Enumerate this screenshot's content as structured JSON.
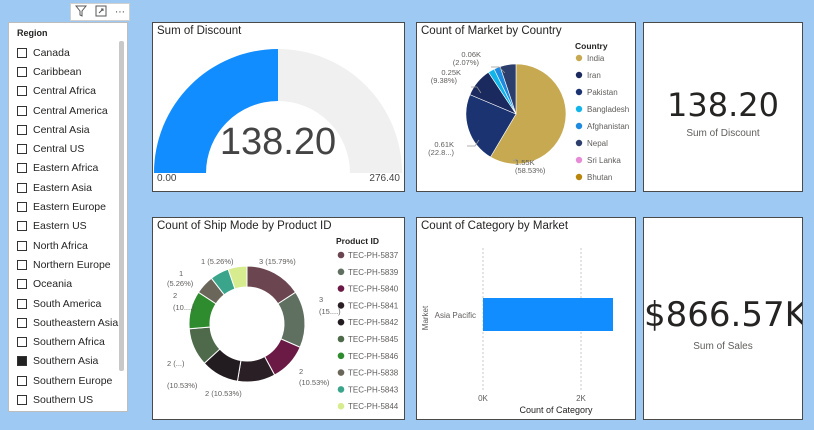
{
  "slicer": {
    "title": "Region",
    "items": [
      {
        "label": "Canada",
        "checked": false
      },
      {
        "label": "Caribbean",
        "checked": false
      },
      {
        "label": "Central Africa",
        "checked": false
      },
      {
        "label": "Central America",
        "checked": false
      },
      {
        "label": "Central Asia",
        "checked": false
      },
      {
        "label": "Central US",
        "checked": false
      },
      {
        "label": "Eastern Africa",
        "checked": false
      },
      {
        "label": "Eastern Asia",
        "checked": false
      },
      {
        "label": "Eastern Europe",
        "checked": false
      },
      {
        "label": "Eastern US",
        "checked": false
      },
      {
        "label": "North Africa",
        "checked": false
      },
      {
        "label": "Northern Europe",
        "checked": false
      },
      {
        "label": "Oceania",
        "checked": false
      },
      {
        "label": "South America",
        "checked": false
      },
      {
        "label": "Southeastern Asia",
        "checked": false
      },
      {
        "label": "Southern Africa",
        "checked": false
      },
      {
        "label": "Southern Asia",
        "checked": true
      },
      {
        "label": "Southern Europe",
        "checked": false
      },
      {
        "label": "Southern US",
        "checked": false
      },
      {
        "label": "",
        "checked": false
      }
    ],
    "toolbar": {
      "filter_icon": "filter-icon",
      "focus_icon": "focus-mode-icon",
      "more_icon": "more-options-icon"
    }
  },
  "gauge": {
    "title": "Sum of Discount",
    "value_label": "138.20",
    "min_label": "0.00",
    "max_label": "276.40",
    "value": 138.2,
    "min": 0,
    "max": 276.4,
    "fill_color": "#118dff",
    "track_color": "#f0f0f0"
  },
  "pie": {
    "title": "Count of Market by Country",
    "legend_title": "Country",
    "legend": [
      {
        "label": "India",
        "color": "#c6a951"
      },
      {
        "label": "Iran",
        "color": "#1a2a5e"
      },
      {
        "label": "Pakistan",
        "color": "#1b3370"
      },
      {
        "label": "Bangladesh",
        "color": "#12b5ea"
      },
      {
        "label": "Afghanistan",
        "color": "#1f8be0"
      },
      {
        "label": "Nepal",
        "color": "#2c3e6b"
      },
      {
        "label": "Sri Lanka",
        "color": "#e88bd6"
      },
      {
        "label": "Bhutan",
        "color": "#b8860b"
      }
    ],
    "labels": [
      {
        "line1": "0.06K",
        "line2": "(2.07%)"
      },
      {
        "line1": "0.25K",
        "line2": "(9.38%)"
      },
      {
        "line1": "0.61K",
        "line2": "(22.8...)"
      },
      {
        "line1": "1.55K",
        "line2": "(58.53%)"
      }
    ]
  },
  "kpi1": {
    "value": "138.20",
    "label": "Sum of Discount"
  },
  "donut": {
    "title": "Count of Ship Mode by Product ID",
    "legend_title": "Product ID",
    "legend": [
      {
        "label": "TEC-PH-5837",
        "color": "#6b4650"
      },
      {
        "label": "TEC-PH-5839",
        "color": "#5f7060"
      },
      {
        "label": "TEC-PH-5840",
        "color": "#6b1a45"
      },
      {
        "label": "TEC-PH-5841",
        "color": "#2a1f25"
      },
      {
        "label": "TEC-PH-5842",
        "color": "#221c20"
      },
      {
        "label": "TEC-PH-5845",
        "color": "#4e6a4a"
      },
      {
        "label": "TEC-PH-5846",
        "color": "#2e8b2e"
      },
      {
        "label": "TEC-PH-5838",
        "color": "#6a665a"
      },
      {
        "label": "TEC-PH-5843",
        "color": "#3aa58a"
      },
      {
        "label": "TEC-PH-5844",
        "color": "#d6ec8f"
      }
    ],
    "labels": [
      "3 (15.79%)",
      "3",
      "(15....)",
      "2",
      "(10.53%)",
      "2 (10.53%)",
      "2 (...)",
      "(10.53%)",
      "2",
      "(10....)",
      "1",
      "(5.26%)",
      "1 (5.26%)"
    ]
  },
  "bar": {
    "title": "Count of Category by Market",
    "ylabel": "Market",
    "xlabel": "Count of Category",
    "category": "Asia Pacific",
    "ticks": [
      "0K",
      "2K"
    ],
    "bar_color": "#118dff"
  },
  "kpi2": {
    "value": "$866.57K",
    "label": "Sum of Sales"
  }
}
